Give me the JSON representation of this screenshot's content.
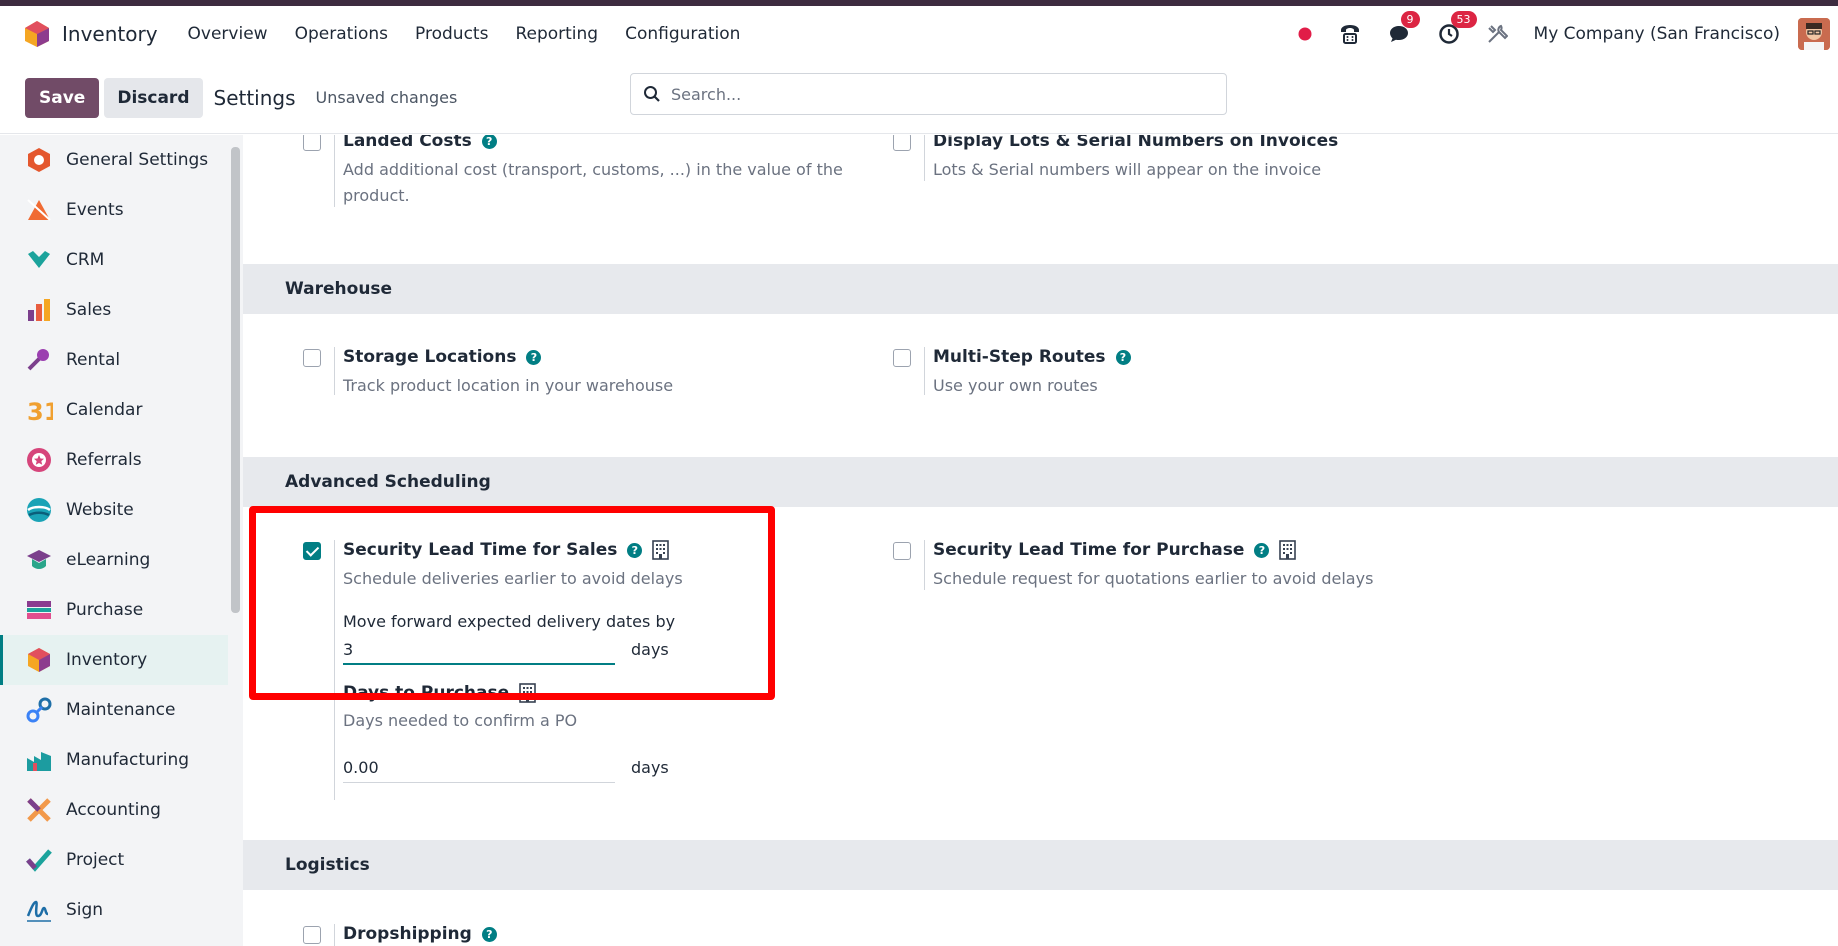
{
  "navbar": {
    "app_name": "Inventory",
    "menu": [
      "Overview",
      "Operations",
      "Products",
      "Reporting",
      "Configuration"
    ],
    "messages_badge": "9",
    "activities_badge": "53",
    "company": "My Company (San Francisco)"
  },
  "control_panel": {
    "save_label": "Save",
    "discard_label": "Discard",
    "title": "Settings",
    "status": "Unsaved changes",
    "search_placeholder": "Search..."
  },
  "sidebar": {
    "items": [
      {
        "label": "General Settings",
        "icon": "general-settings-icon",
        "color": "#e4572e"
      },
      {
        "label": "Events",
        "icon": "events-icon",
        "color": "#f06b33"
      },
      {
        "label": "CRM",
        "icon": "crm-icon",
        "color": "#1ba39c"
      },
      {
        "label": "Sales",
        "icon": "sales-icon",
        "color": "#e85d3f"
      },
      {
        "label": "Rental",
        "icon": "rental-icon",
        "color": "#9b3fb0"
      },
      {
        "label": "Calendar",
        "icon": "calendar-icon",
        "color": "#f0a030"
      },
      {
        "label": "Referrals",
        "icon": "referrals-icon",
        "color": "#d6457b"
      },
      {
        "label": "Website",
        "icon": "website-icon",
        "color": "#1aa3b6"
      },
      {
        "label": "eLearning",
        "icon": "elearning-icon",
        "color": "#2aa58a"
      },
      {
        "label": "Purchase",
        "icon": "purchase-icon",
        "color": "#8a3b8f"
      },
      {
        "label": "Inventory",
        "icon": "inventory-icon",
        "color": "#e67e22",
        "active": true
      },
      {
        "label": "Maintenance",
        "icon": "maintenance-icon",
        "color": "#3b82f6"
      },
      {
        "label": "Manufacturing",
        "icon": "manufacturing-icon",
        "color": "#1c9ca0"
      },
      {
        "label": "Accounting",
        "icon": "accounting-icon",
        "color": "#f2994a"
      },
      {
        "label": "Project",
        "icon": "project-icon",
        "color": "#1ba39c"
      },
      {
        "label": "Sign",
        "icon": "sign-icon",
        "color": "#1e6ea7"
      }
    ]
  },
  "settings": {
    "landed_costs": {
      "title": "Landed Costs",
      "desc": "Add additional cost (transport, customs, ...) in the value of the product."
    },
    "display_lots": {
      "title": "Display Lots & Serial Numbers on Invoices",
      "desc": "Lots & Serial numbers will appear on the invoice"
    },
    "warehouse": {
      "header": "Warehouse",
      "storage": {
        "title": "Storage Locations",
        "desc": "Track product location in your warehouse"
      },
      "routes": {
        "title": "Multi-Step Routes",
        "desc": "Use your own routes"
      }
    },
    "advanced": {
      "header": "Advanced Scheduling",
      "sales_lead": {
        "title": "Security Lead Time for Sales",
        "desc": "Schedule deliveries earlier to avoid delays",
        "field_label": "Move forward expected delivery dates by",
        "value": "3",
        "unit": "days",
        "checked": true
      },
      "purchase_lead": {
        "title": "Security Lead Time for Purchase",
        "desc": "Schedule request for quotations earlier to avoid delays",
        "checked": false
      },
      "days_to_purchase": {
        "title": "Days to Purchase",
        "desc": "Days needed to confirm a PO",
        "value": "0.00",
        "unit": "days"
      }
    },
    "logistics": {
      "header": "Logistics",
      "dropshipping": {
        "title": "Dropshipping"
      }
    }
  },
  "colors": {
    "brand": "#714b67",
    "accent": "#017e84",
    "highlight": "#ff0000",
    "badge": "#dc2543"
  }
}
